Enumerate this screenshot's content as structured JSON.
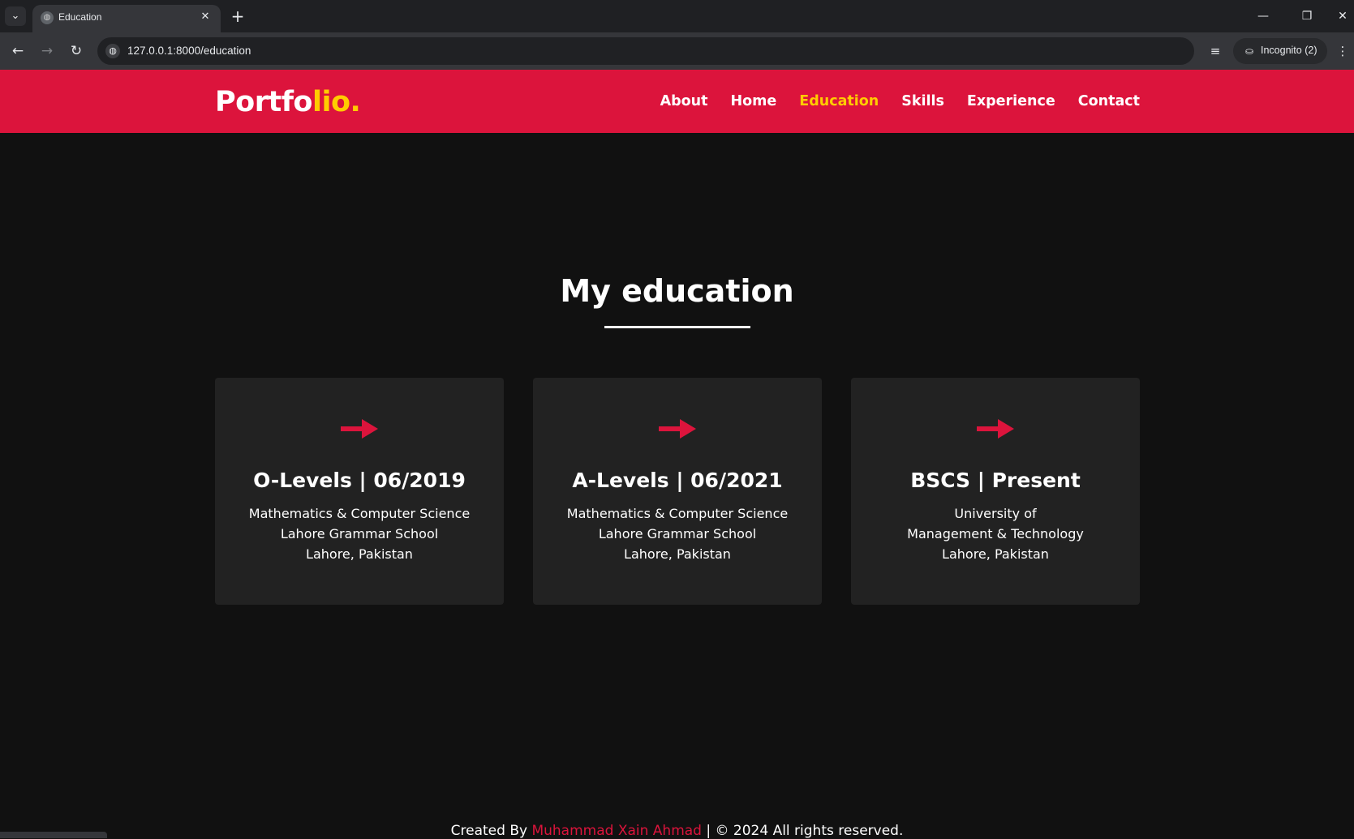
{
  "browser": {
    "tab_title": "Education",
    "url": "127.0.0.1:8000/education",
    "incognito_label": "Incognito (2)"
  },
  "site": {
    "logo_main": "Portfo",
    "logo_accent": "lio.",
    "brand_color": "#dc143c",
    "accent_color": "#ffcc00",
    "nav": [
      {
        "label": "About",
        "active": false
      },
      {
        "label": "Home",
        "active": false
      },
      {
        "label": "Education",
        "active": true
      },
      {
        "label": "Skills",
        "active": false
      },
      {
        "label": "Experience",
        "active": false
      },
      {
        "label": "Contact",
        "active": false
      }
    ]
  },
  "main": {
    "title": "My education",
    "cards": [
      {
        "icon": "right-arrow-icon",
        "title": "O-Levels | 06/2019",
        "lines": [
          "Mathematics & Computer Science",
          "Lahore Grammar School",
          "Lahore, Pakistan"
        ]
      },
      {
        "icon": "right-arrow-icon",
        "title": "A-Levels | 06/2021",
        "lines": [
          "Mathematics & Computer Science",
          "Lahore Grammar School",
          "Lahore, Pakistan"
        ]
      },
      {
        "icon": "right-arrow-icon",
        "title": "BSCS | Present",
        "lines": [
          "University of",
          "Management & Technology",
          "Lahore, Pakistan"
        ]
      }
    ]
  },
  "footer": {
    "prefix": "Created By ",
    "author": "Muhammad Xain Ahmad",
    "suffix": " | © 2024 All rights reserved."
  }
}
